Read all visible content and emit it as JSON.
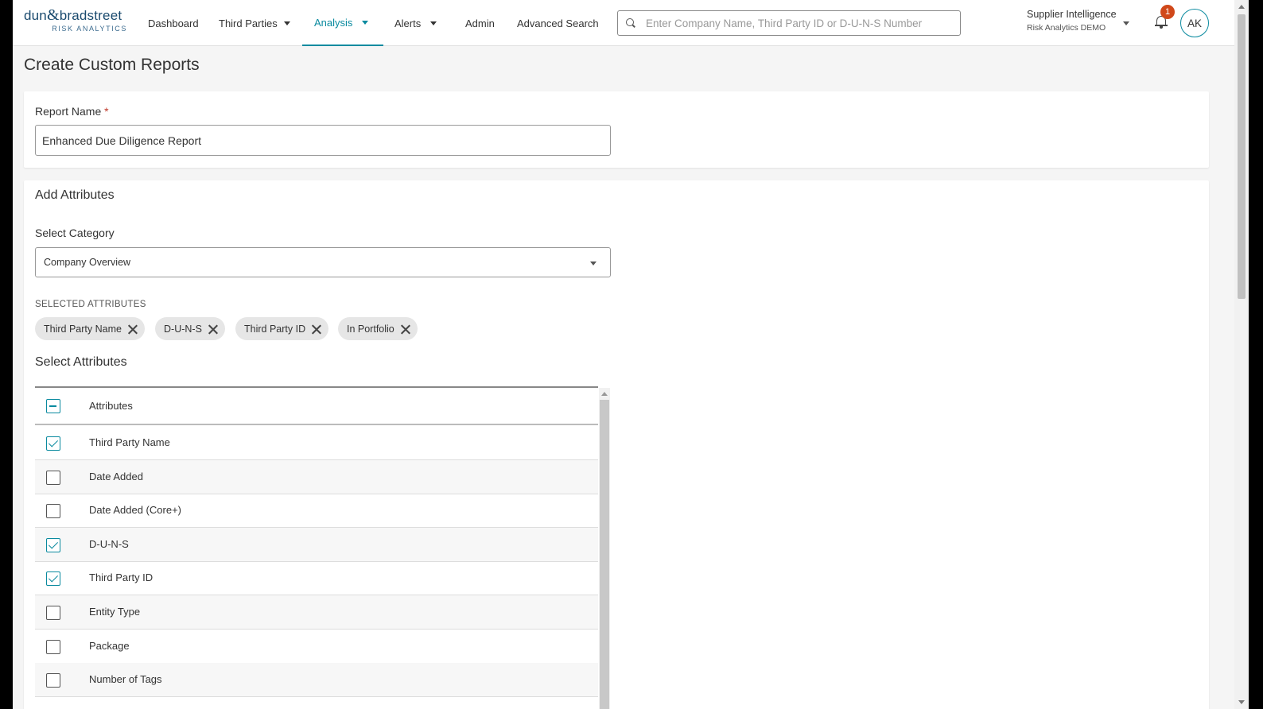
{
  "header": {
    "logo_main": "dun",
    "logo_amp": "&",
    "logo_main2": "bradstreet",
    "logo_sub": "RISK ANALYTICS",
    "nav": [
      {
        "label": "Dashboard"
      },
      {
        "label": "Third Parties"
      },
      {
        "label": "Analysis"
      },
      {
        "label": "Alerts"
      },
      {
        "label": "Admin"
      },
      {
        "label": "Advanced Search"
      }
    ],
    "search_placeholder": "Enter Company Name, Third Party ID or D-U-N-S Number",
    "org_name": "Supplier Intelligence",
    "org_sub": "Risk Analytics DEMO",
    "notification_count": "1",
    "avatar_initials": "AK"
  },
  "page": {
    "title": "Create Custom Reports"
  },
  "report": {
    "name_label": "Report Name",
    "required_mark": "*",
    "name_value": "Enhanced Due Diligence Report"
  },
  "attributes": {
    "section_title": "Add Attributes",
    "category_label": "Select Category",
    "category_value": "Company Overview",
    "selected_label": "SELECTED ATTRIBUTES",
    "selected": [
      {
        "label": "Third Party Name"
      },
      {
        "label": "D-U-N-S"
      },
      {
        "label": "Third Party ID"
      },
      {
        "label": "In Portfolio"
      }
    ],
    "select_title": "Select Attributes",
    "table_header": "Attributes",
    "rows": [
      {
        "label": "Third Party Name",
        "checked": true
      },
      {
        "label": "Date Added",
        "checked": false
      },
      {
        "label": "Date Added (Core+)",
        "checked": false
      },
      {
        "label": "D-U-N-S",
        "checked": true
      },
      {
        "label": "Third Party ID",
        "checked": true
      },
      {
        "label": "Entity Type",
        "checked": false
      },
      {
        "label": "Package",
        "checked": false
      },
      {
        "label": "Number of Tags",
        "checked": false
      }
    ]
  },
  "colors": {
    "accent": "#0a8a9f",
    "badge": "#d0481a",
    "required": "#c0392b"
  }
}
